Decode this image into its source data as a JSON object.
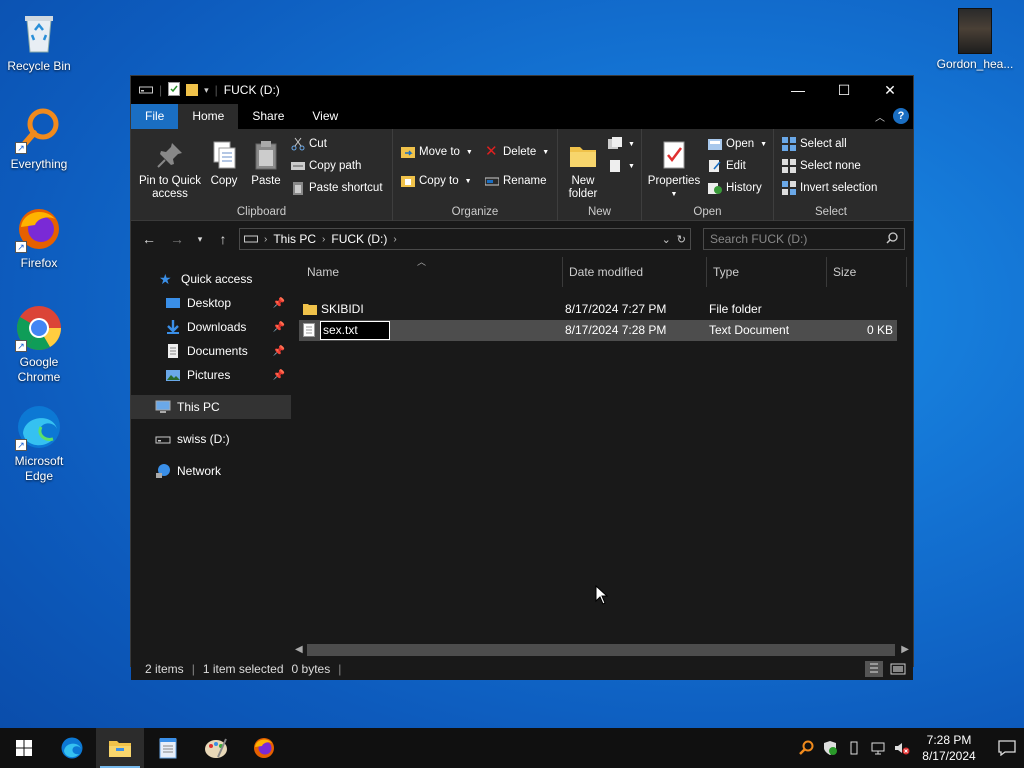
{
  "desktop": {
    "icons": [
      {
        "label": "Recycle Bin"
      },
      {
        "label": "Everything"
      },
      {
        "label": "Firefox"
      },
      {
        "label": "Google Chrome"
      },
      {
        "label": "Microsoft Edge"
      },
      {
        "label": "Gordon_hea..."
      }
    ]
  },
  "window": {
    "title": "FUCK (D:)",
    "controls": {
      "minimize": "—",
      "maximize": "☐",
      "close": "✕"
    }
  },
  "ribbon": {
    "tabs": [
      {
        "label": "File"
      },
      {
        "label": "Home"
      },
      {
        "label": "Share"
      },
      {
        "label": "View"
      }
    ],
    "clipboard": {
      "label": "Clipboard",
      "pin": "Pin to Quick access",
      "pin_line1": "Pin to Quick",
      "pin_line2": "access",
      "copy": "Copy",
      "paste": "Paste",
      "cut": "Cut",
      "copy_path": "Copy path",
      "paste_shortcut": "Paste shortcut"
    },
    "organize": {
      "label": "Organize",
      "move_to": "Move to",
      "copy_to": "Copy to",
      "delete": "Delete",
      "rename": "Rename"
    },
    "new": {
      "label": "New",
      "new_folder_line1": "New",
      "new_folder_line2": "folder"
    },
    "open": {
      "label": "Open",
      "properties": "Properties",
      "open": "Open",
      "edit": "Edit",
      "history": "History"
    },
    "select": {
      "label": "Select",
      "select_all": "Select all",
      "select_none": "Select none",
      "invert": "Invert selection"
    }
  },
  "address": {
    "crumbs": [
      "This PC",
      "FUCK (D:)"
    ],
    "search_placeholder": "Search FUCK (D:)"
  },
  "nav": {
    "quick_access": "Quick access",
    "desktop": "Desktop",
    "downloads": "Downloads",
    "documents": "Documents",
    "pictures": "Pictures",
    "this_pc": "This PC",
    "drive": "swiss (D:)",
    "network": "Network"
  },
  "columns": {
    "name": "Name",
    "date": "Date modified",
    "type": "Type",
    "size": "Size"
  },
  "files": [
    {
      "name": "SKIBIDI",
      "date": "8/17/2024 7:27 PM",
      "type": "File folder",
      "size": ""
    },
    {
      "name": "sex.txt",
      "date": "8/17/2024 7:28 PM",
      "type": "Text Document",
      "size": "0 KB"
    }
  ],
  "status": {
    "items": "2 items",
    "selected": "1 item selected",
    "bytes": "0 bytes"
  },
  "taskbar": {
    "time": "7:28 PM",
    "date": "8/17/2024"
  },
  "colors": {
    "accent": "#1a6ec2",
    "folder": "#f0c24a",
    "desktop_bg": "#1474d4"
  }
}
